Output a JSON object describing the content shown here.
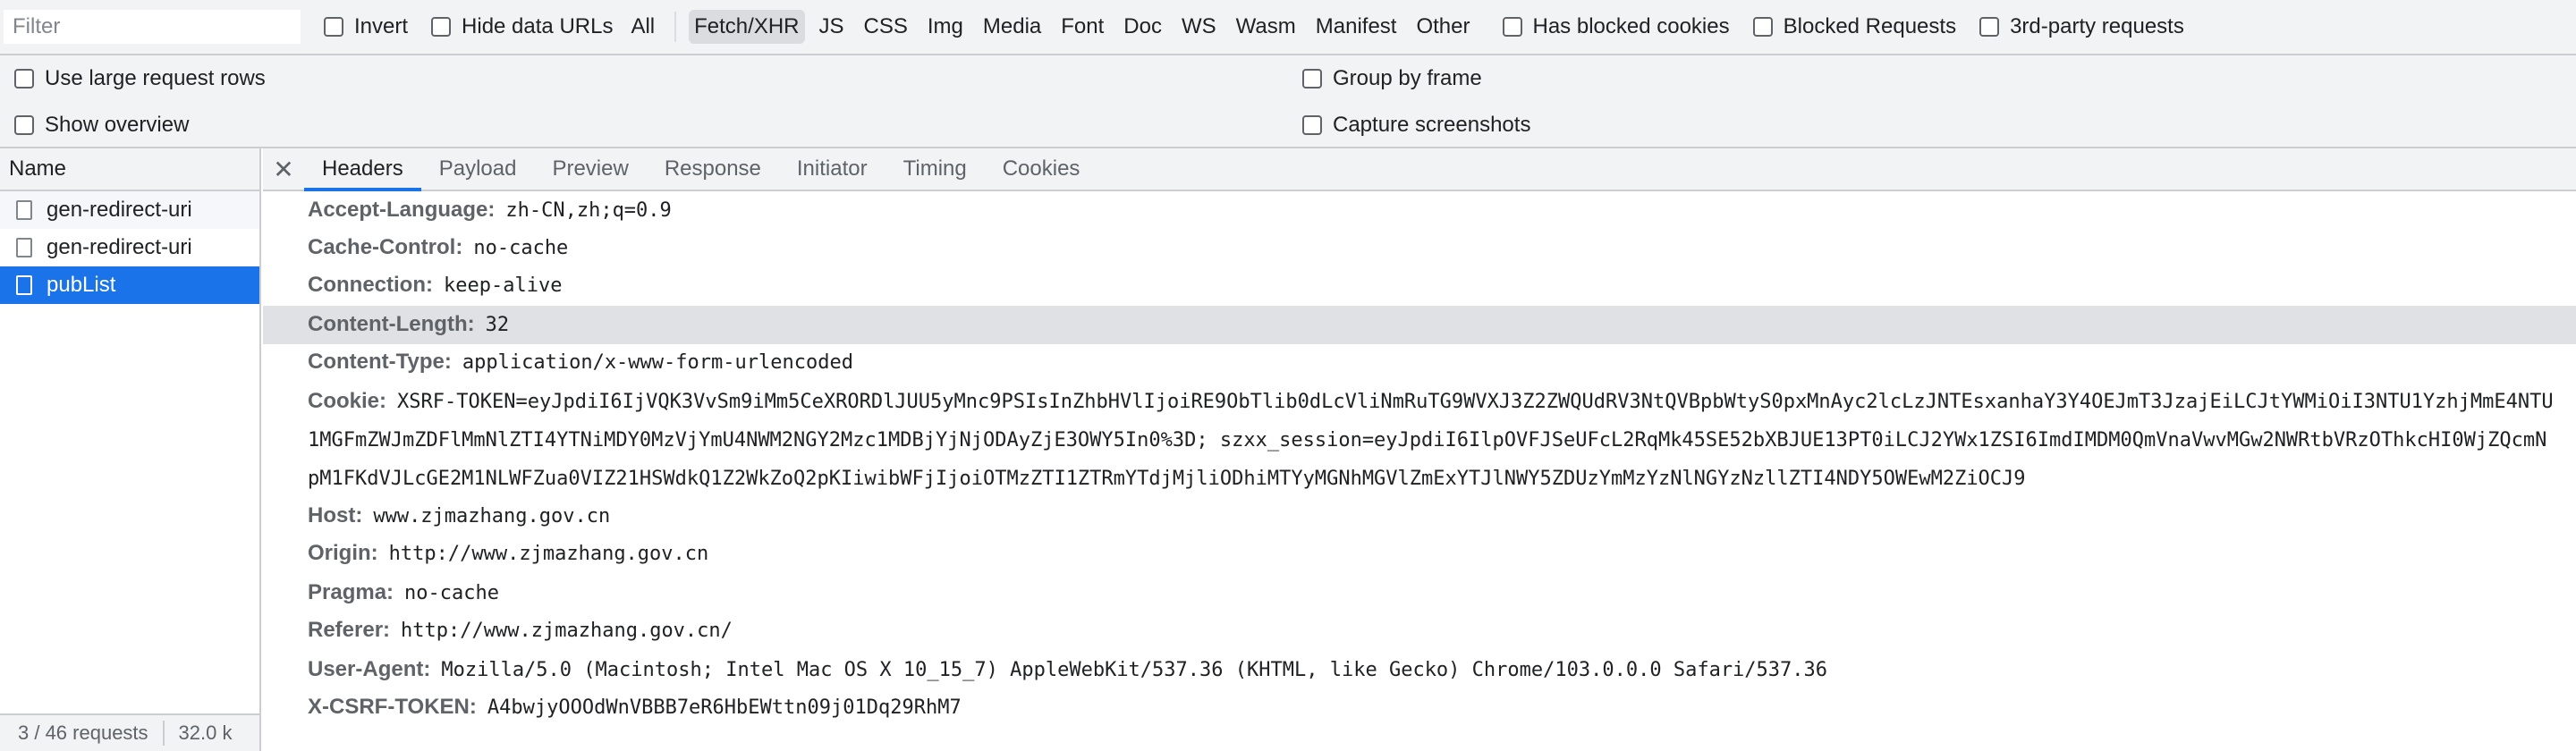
{
  "filter_bar": {
    "placeholder": "Filter",
    "invert_label": "Invert",
    "hide_data_urls_label": "Hide data URLs",
    "types": [
      "All",
      "Fetch/XHR",
      "JS",
      "CSS",
      "Img",
      "Media",
      "Font",
      "Doc",
      "WS",
      "Wasm",
      "Manifest",
      "Other"
    ],
    "active_type": "Fetch/XHR",
    "has_blocked_cookies_label": "Has blocked cookies",
    "blocked_requests_label": "Blocked Requests",
    "third_party_label": "3rd-party requests"
  },
  "settings": {
    "large_rows_label": "Use large request rows",
    "show_overview_label": "Show overview",
    "group_by_frame_label": "Group by frame",
    "capture_screenshots_label": "Capture screenshots"
  },
  "name_panel": {
    "header": "Name",
    "requests": [
      {
        "name": "gen-redirect-uri"
      },
      {
        "name": "gen-redirect-uri"
      },
      {
        "name": "pubList"
      }
    ]
  },
  "status_bar": {
    "requests": "3 / 46 requests",
    "size": "32.0 k"
  },
  "detail_tabs": [
    "Headers",
    "Payload",
    "Preview",
    "Response",
    "Initiator",
    "Timing",
    "Cookies"
  ],
  "active_tab": "Headers",
  "headers": [
    {
      "key": "Accept-Language:",
      "value": "zh-CN,zh;q=0.9"
    },
    {
      "key": "Cache-Control:",
      "value": "no-cache"
    },
    {
      "key": "Connection:",
      "value": "keep-alive"
    },
    {
      "key": "Content-Length:",
      "value": "32"
    },
    {
      "key": "Content-Type:",
      "value": "application/x-www-form-urlencoded"
    },
    {
      "key": "Cookie:",
      "value": "XSRF-TOKEN=eyJpdiI6IjVQK3VvSm9iMm5CeXRORDlJUU5yMnc9PSIsInZhbHVlIjoiRE9ObTlib0dLcVliNmRuTG9WVXJ3Z2ZWQUdRV3NtQVBpbWtyS0pxMnAyc2lcLzJNTEsxanhaY3Y4OEJmT3JzajEiLCJtYWMiOiI3NTU1YzhjMmE4NTU1MGFmZWJmZDFlMmNlZTI4YTNiMDY0MzVjYmU4NWM2NGY2Mzc1MDBjYjNjODAyZjE3OWY5In0%3D; szxx_session=eyJpdiI6IlpOVFJSeUFcL2RqMk45SE52bXBJUE13PT0iLCJ2YWx1ZSI6ImdIMDM0QmVnaVwvMGw2NWRtbVRzOThkcHI0WjZQcmNpM1FKdVJLcGE2M1NLWFZua0VIZ21HSWdkQ1Z2WkZoQ2pKIiwibWFjIjoiOTMzZTI1ZTRmYTdjMjliODhiMTYyMGNhMGVlZmExYTJlNWY5ZDUzYmMzYzNlNGYzNzllZTI4NDY5OWEwM2ZiOCJ9"
    },
    {
      "key": "Host:",
      "value": "www.zjmazhang.gov.cn"
    },
    {
      "key": "Origin:",
      "value": "http://www.zjmazhang.gov.cn"
    },
    {
      "key": "Pragma:",
      "value": "no-cache"
    },
    {
      "key": "Referer:",
      "value": "http://www.zjmazhang.gov.cn/"
    },
    {
      "key": "User-Agent:",
      "value": "Mozilla/5.0 (Macintosh; Intel Mac OS X 10_15_7) AppleWebKit/537.36 (KHTML, like Gecko) Chrome/103.0.0.0 Safari/537.36"
    },
    {
      "key": "X-CSRF-TOKEN:",
      "value": "A4bwjyOOOdWnVBBB7eR6HbEWttn09j01Dq29RhM7"
    }
  ],
  "colors": {
    "accent": "#1a73e8",
    "toolbar_bg": "#f1f3f4",
    "highlight_row": "#dfe1e5"
  }
}
